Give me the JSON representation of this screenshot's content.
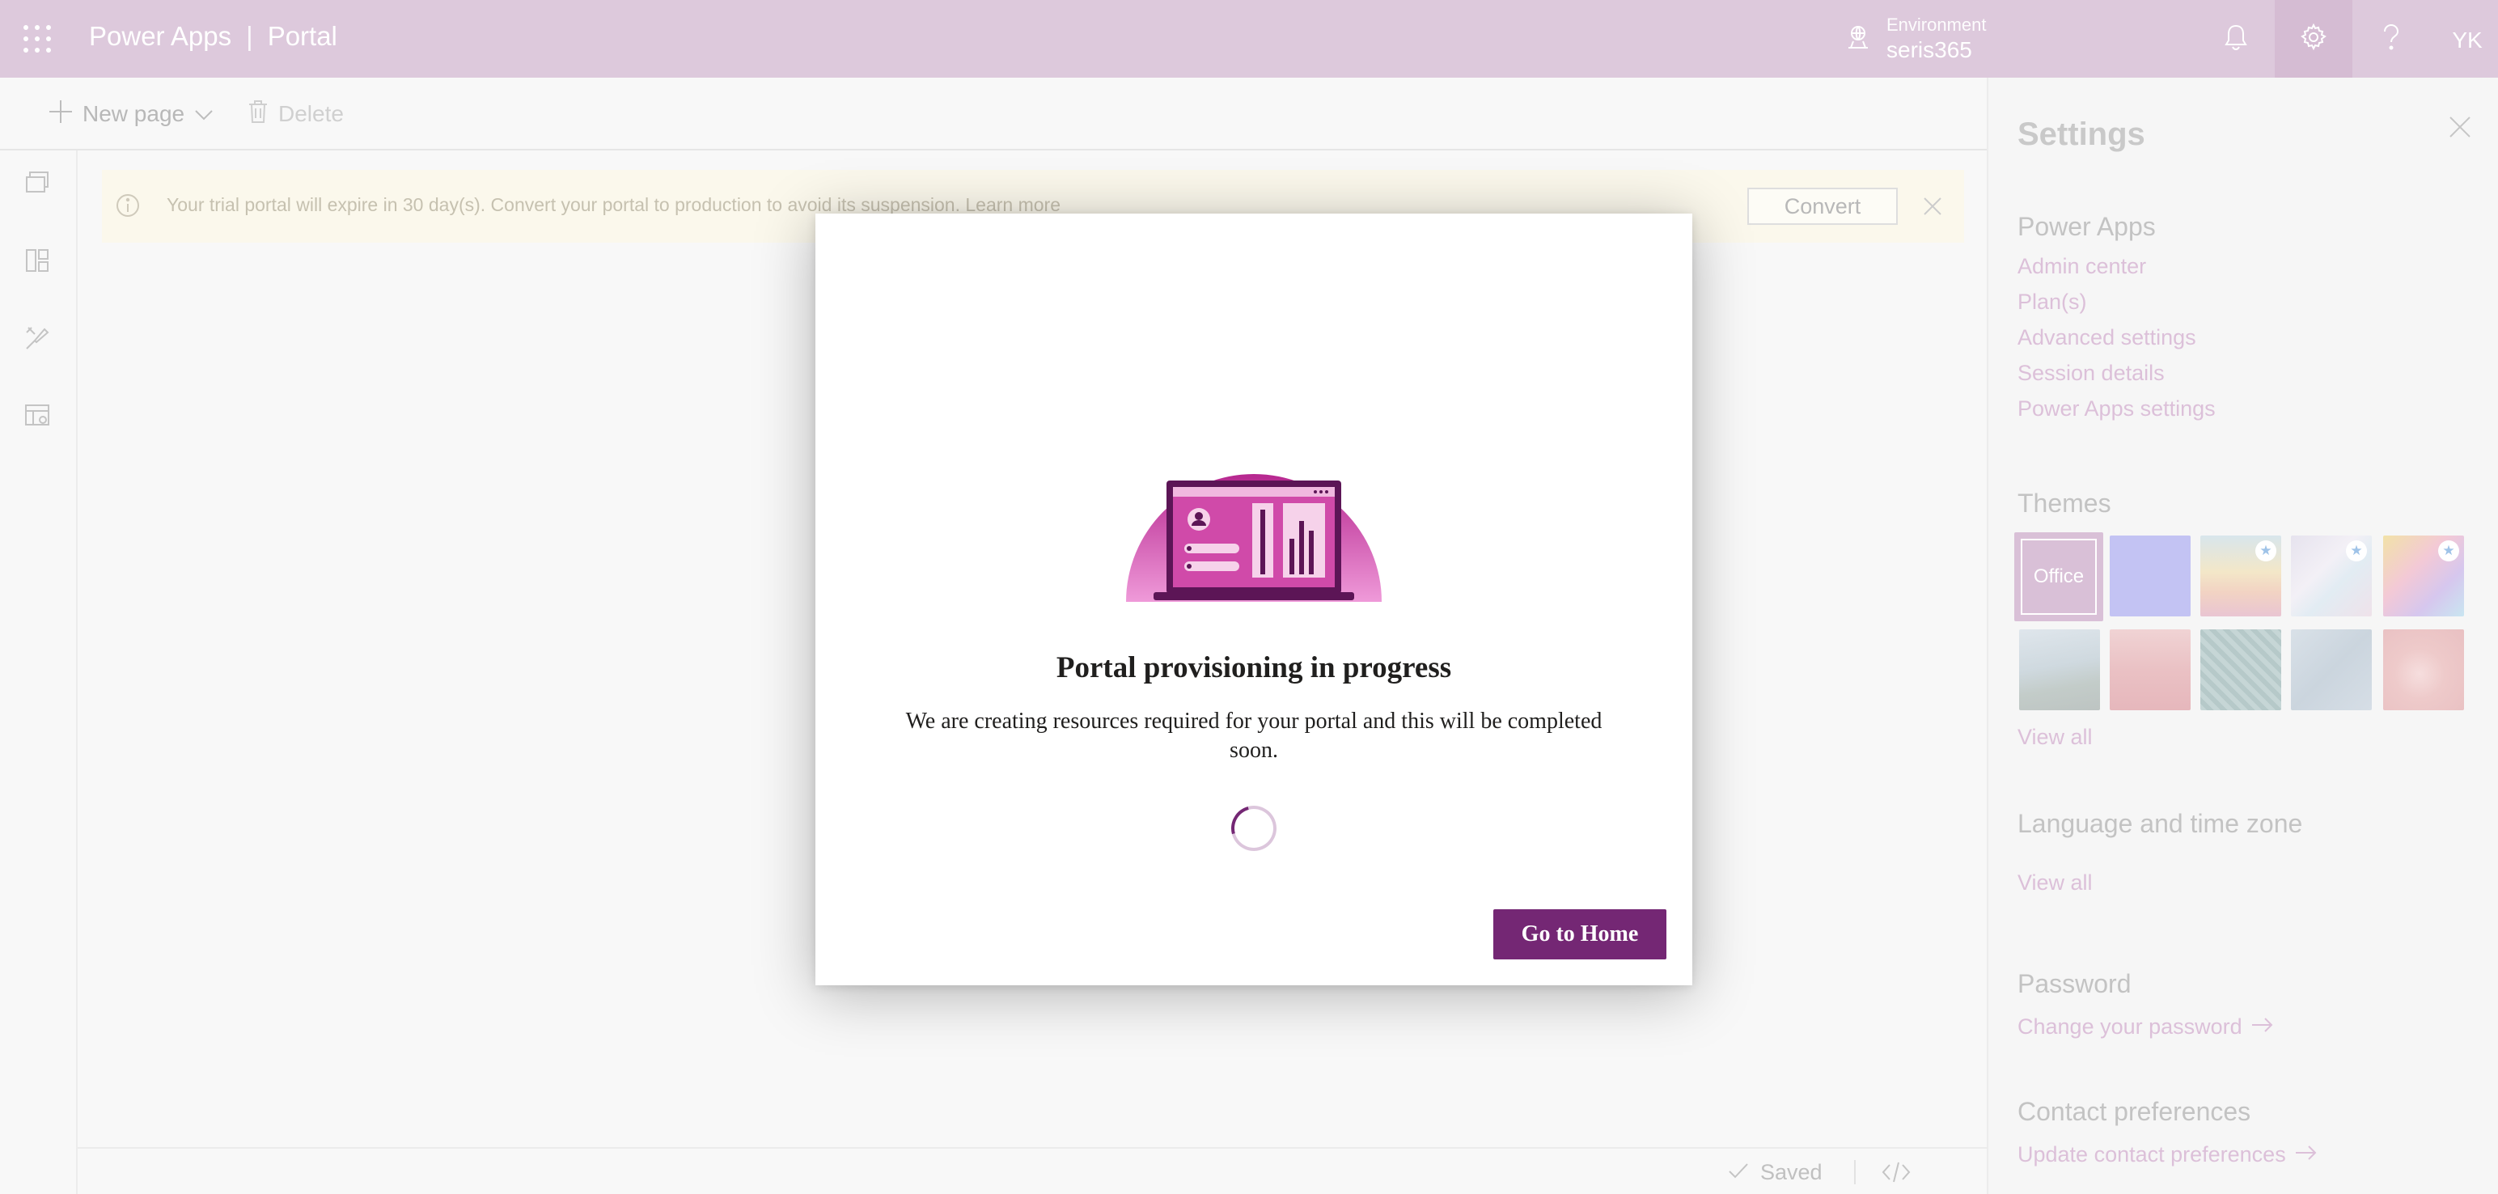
{
  "header": {
    "app_name": "Power Apps",
    "separator": "|",
    "product": "Portal",
    "environment_label": "Environment",
    "environment_value": "seris365",
    "avatar_initials": "YK",
    "icons": [
      "waffle-icon",
      "environment-icon",
      "bell-icon",
      "gear-icon",
      "help-icon"
    ]
  },
  "command_bar": {
    "new_page_label": "New page",
    "delete_label": "Delete"
  },
  "left_rail": {
    "icons": [
      "pages-icon",
      "components-icon",
      "themes-icon",
      "templates-icon"
    ]
  },
  "banner": {
    "message": "Your trial portal will expire in 30 day(s). Convert your portal to production to avoid its suspension. Learn more",
    "convert_label": "Convert"
  },
  "footer": {
    "saved_label": "Saved"
  },
  "settings": {
    "title": "Settings",
    "power_apps": {
      "title": "Power Apps",
      "links": [
        "Admin center",
        "Plan(s)",
        "Advanced settings",
        "Session details",
        "Power Apps settings"
      ]
    },
    "themes": {
      "title": "Themes",
      "selected_label": "Office",
      "view_all": "View all"
    },
    "language": {
      "title": "Language and time zone",
      "view_all": "View all"
    },
    "password": {
      "title": "Password",
      "link": "Change your password"
    },
    "contact": {
      "title": "Contact preferences",
      "link": "Update contact preferences"
    }
  },
  "modal": {
    "title": "Portal provisioning in progress",
    "description": "We are creating resources required for your portal and this will be completed soon.",
    "button_label": "Go to Home"
  },
  "colors": {
    "header_bg": "#ddc9dc",
    "accent": "#742774",
    "banner_bg": "#fbf8ec"
  }
}
